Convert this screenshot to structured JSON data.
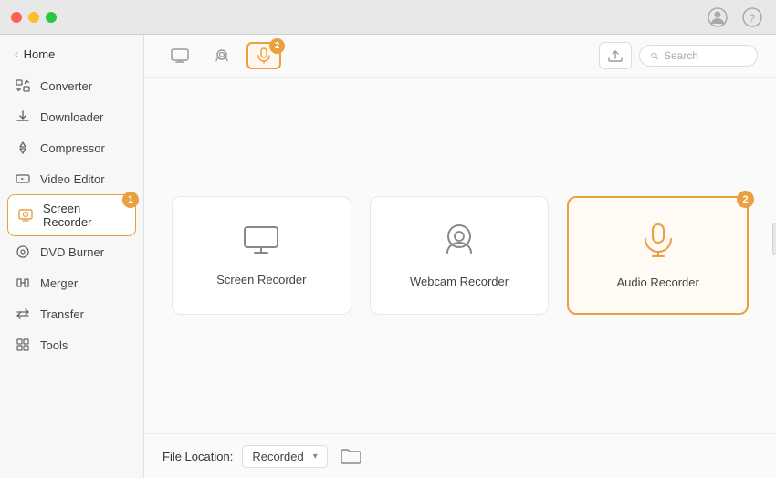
{
  "titleBar": {
    "trafficLights": [
      "red",
      "yellow",
      "green"
    ]
  },
  "sidebar": {
    "homeLabel": "Home",
    "chevron": "‹",
    "items": [
      {
        "id": "converter",
        "label": "Converter",
        "icon": "⊞",
        "active": false
      },
      {
        "id": "downloader",
        "label": "Downloader",
        "icon": "↓",
        "active": false
      },
      {
        "id": "compressor",
        "label": "Compressor",
        "icon": "⬡",
        "active": false
      },
      {
        "id": "video-editor",
        "label": "Video Editor",
        "icon": "✂",
        "active": false
      },
      {
        "id": "screen-recorder",
        "label": "Screen Recorder",
        "icon": "▣",
        "active": true,
        "badge": "1"
      },
      {
        "id": "dvd-burner",
        "label": "DVD Burner",
        "icon": "⊙",
        "active": false
      },
      {
        "id": "merger",
        "label": "Merger",
        "icon": "⊞",
        "active": false
      },
      {
        "id": "transfer",
        "label": "Transfer",
        "icon": "⇄",
        "active": false
      },
      {
        "id": "tools",
        "label": "Tools",
        "icon": "⊞",
        "active": false
      }
    ]
  },
  "toolbar": {
    "tabs": [
      {
        "id": "screen",
        "icon": "▭",
        "active": false
      },
      {
        "id": "webcam",
        "icon": "◉",
        "active": false
      },
      {
        "id": "audio",
        "icon": "🎙",
        "active": true,
        "badge": "2"
      }
    ],
    "uploadIcon": "⬆",
    "searchPlaceholder": "Search"
  },
  "cards": [
    {
      "id": "screen-recorder",
      "label": "Screen Recorder",
      "icon": "🖥",
      "selected": false
    },
    {
      "id": "webcam-recorder",
      "label": "Webcam Recorder",
      "icon": "📷",
      "selected": false
    },
    {
      "id": "audio-recorder",
      "label": "Audio Recorder",
      "icon": "🎙",
      "selected": true,
      "badge": "2"
    }
  ],
  "bottomBar": {
    "label": "File Location:",
    "locationValue": "Recorded",
    "dropdownArrow": "▾",
    "folderIcon": "📁"
  },
  "collapseBtn": "‹"
}
